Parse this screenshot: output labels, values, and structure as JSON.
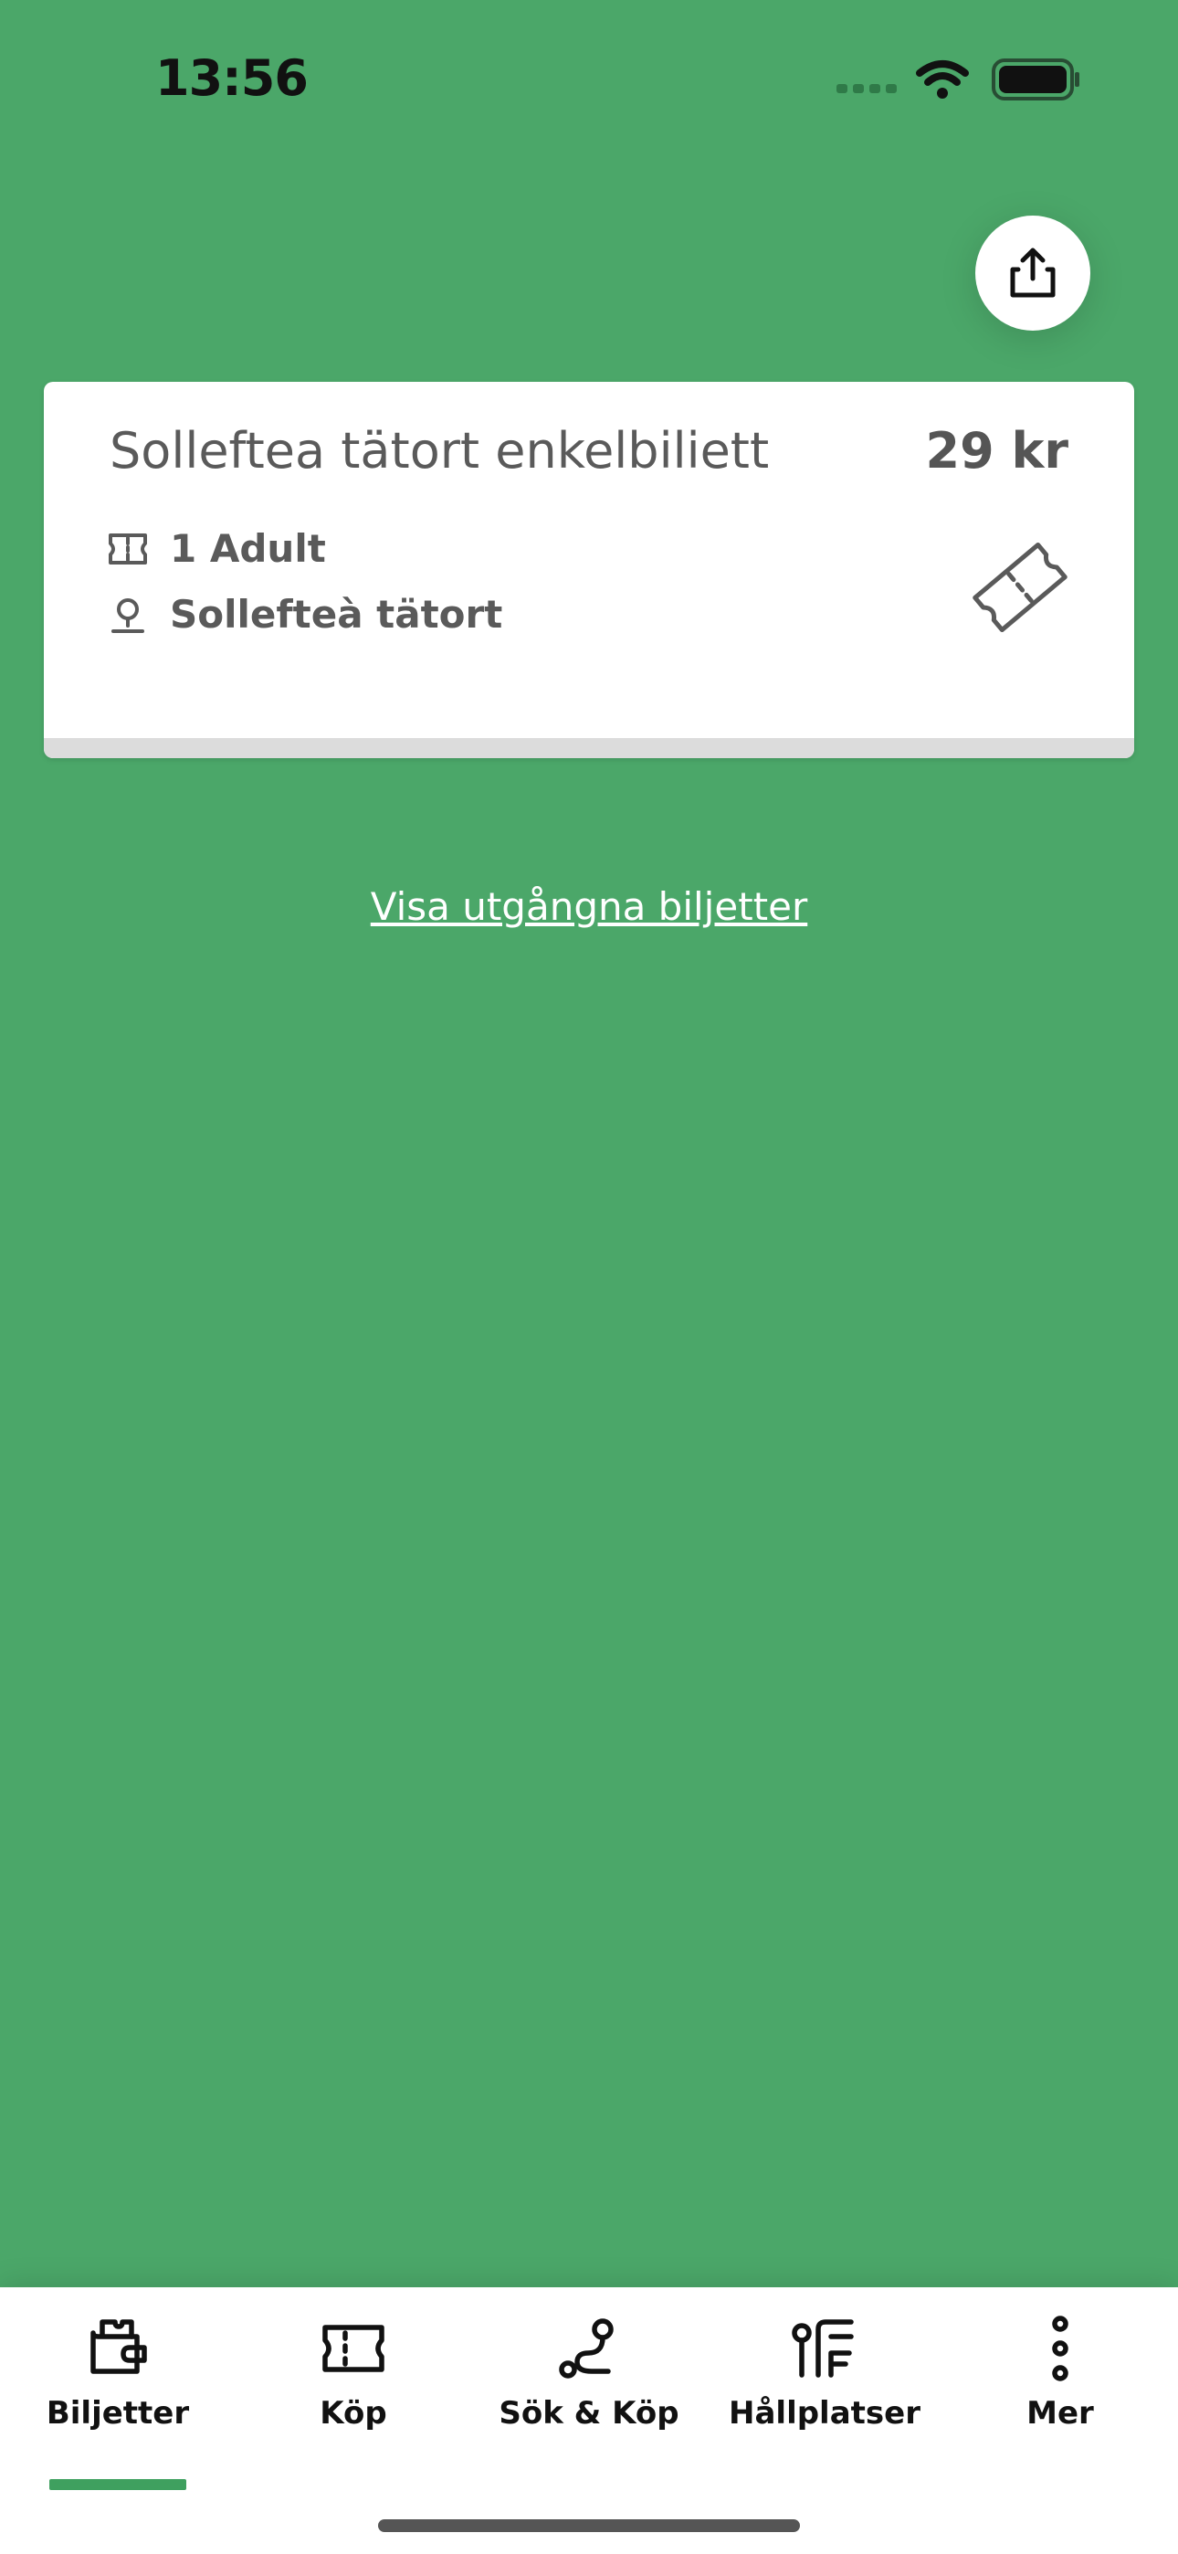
{
  "status_bar": {
    "time": "13:56"
  },
  "ticket": {
    "title": "Solleftea tätort enkelbiliett",
    "price": "29 kr",
    "passengers": "1 Adult",
    "zone": "Sollefteà tätort"
  },
  "expired_link": "Visa utgångna biljetter",
  "tabbar": {
    "active_tab": "Biljetter",
    "tabs": [
      {
        "label": "Biljetter",
        "icon": "wallet-ticket-icon"
      },
      {
        "label": "Köp",
        "icon": "ticket-icon"
      },
      {
        "label": "Sök & Köp",
        "icon": "route-icon"
      },
      {
        "label": "Hållplatser",
        "icon": "bus-stop-icon"
      },
      {
        "label": "Mer",
        "icon": "more-vertical-icon"
      }
    ]
  },
  "colors": {
    "background": "#4ba769",
    "accent": "#3fa05f",
    "card": "#ffffff",
    "text_muted": "#5a5a5a"
  }
}
